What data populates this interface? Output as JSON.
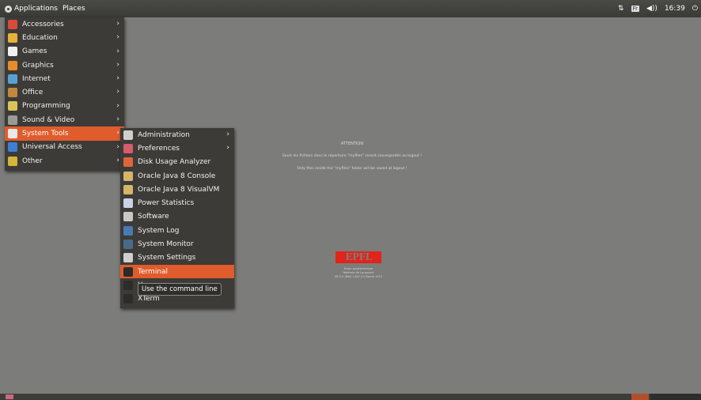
{
  "top_panel": {
    "applications_label": "Applications",
    "places_label": "Places",
    "keyboard_layout": "Fr",
    "clock": "16:39",
    "icons": [
      "network-icon",
      "keyboard-layout-icon",
      "volume-icon",
      "power-icon"
    ]
  },
  "applications_menu": {
    "items": [
      {
        "label": "Accessories",
        "icon": "accessories-icon",
        "color": "#d64b3b"
      },
      {
        "label": "Education",
        "icon": "education-icon",
        "color": "#e6b23c"
      },
      {
        "label": "Games",
        "icon": "games-icon",
        "color": "#f0f0f0"
      },
      {
        "label": "Graphics",
        "icon": "graphics-icon",
        "color": "#e88b2c"
      },
      {
        "label": "Internet",
        "icon": "internet-icon",
        "color": "#5a9fd4"
      },
      {
        "label": "Office",
        "icon": "office-icon",
        "color": "#c0873e"
      },
      {
        "label": "Programming",
        "icon": "programming-icon",
        "color": "#d9c45a"
      },
      {
        "label": "Sound & Video",
        "icon": "sound-video-icon",
        "color": "#9a9a97"
      },
      {
        "label": "System Tools",
        "icon": "system-tools-icon",
        "color": "#e8e8e6"
      },
      {
        "label": "Universal Access",
        "icon": "universal-access-icon",
        "color": "#3f7fcf"
      },
      {
        "label": "Other",
        "icon": "other-icon",
        "color": "#d4b43a"
      }
    ],
    "active_index": 8
  },
  "system_tools_menu": {
    "items": [
      {
        "label": "Administration",
        "icon": "administration-icon",
        "color": "#cfcfcd",
        "submenu": true
      },
      {
        "label": "Preferences",
        "icon": "preferences-icon",
        "color": "#d65b6b",
        "submenu": true
      },
      {
        "label": "Disk Usage Analyzer",
        "icon": "disk-usage-analyzer-icon",
        "color": "#e0663a",
        "submenu": false
      },
      {
        "label": "Oracle Java 8 Console",
        "icon": "java-console-icon",
        "color": "#d8b46a",
        "submenu": false
      },
      {
        "label": "Oracle Java 8 VisualVM",
        "icon": "java-visualvm-icon",
        "color": "#d8b46a",
        "submenu": false
      },
      {
        "label": "Power Statistics",
        "icon": "power-statistics-icon",
        "color": "#c8d4e4",
        "submenu": false
      },
      {
        "label": "Software",
        "icon": "software-icon",
        "color": "#c8c8c6",
        "submenu": false
      },
      {
        "label": "System Log",
        "icon": "system-log-icon",
        "color": "#4a7ab4",
        "submenu": false
      },
      {
        "label": "System Monitor",
        "icon": "system-monitor-icon",
        "color": "#4a6a8a",
        "submenu": false
      },
      {
        "label": "System Settings",
        "icon": "system-settings-icon",
        "color": "#cfcfcd",
        "submenu": false
      },
      {
        "label": "Terminal",
        "icon": "terminal-icon",
        "color": "#2c2c2a",
        "submenu": false
      },
      {
        "label": "U",
        "icon": "uxterm-icon",
        "color": "#2c2c2a",
        "submenu": false
      },
      {
        "label": "XTerm",
        "icon": "xterm-icon",
        "color": "#2c2c2a",
        "submenu": false
      }
    ],
    "active_index": 10,
    "tooltip": "Use the command line"
  },
  "desktop_notice": {
    "title": "ATTENTION",
    "line_fr": "Seuls les fichiers dans le répertoire \"myfiles\" seront sauvegardés au logout !",
    "line_en": "Only files inside the \"myfiles\" folder will be saved at logout !"
  },
  "epfl": {
    "logo_text": "EPFL",
    "address_lines": [
      "Ecole polytechnique",
      "fédérale de Lausanne",
      "SB 3.2 (Bât) 1200 (C) Berne 1015"
    ]
  },
  "colors": {
    "desktop": "#7c7c7a",
    "menu_bg": "#3c3b37",
    "accent": "#e05c2c",
    "epfl_red": "#e2231a"
  }
}
